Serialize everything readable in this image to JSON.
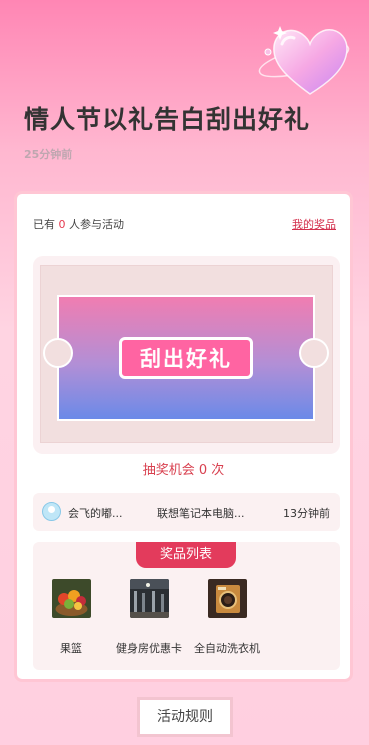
{
  "header": {
    "title": "情人节以礼告白刮出好礼",
    "time_ago": "25分钟前"
  },
  "card": {
    "participants_prefix": "已有",
    "participants_count": "0",
    "participants_suffix": "人参与活动",
    "my_prizes_link": "我的奖品",
    "scratch_label": "刮出好礼",
    "chances_prefix": "抽奖机会",
    "chances_count": "0",
    "chances_suffix": "次",
    "winner": {
      "name": "会飞的嘟...",
      "prize": "联想笔记本电脑...",
      "time": "13分钟前"
    },
    "prize_list_title": "奖品列表",
    "prizes": [
      {
        "name": "果篮",
        "icon": "fruit-basket-image"
      },
      {
        "name": "健身房优惠卡",
        "icon": "gym-image"
      },
      {
        "name": "全自动洗衣机",
        "icon": "washing-machine-image"
      }
    ]
  },
  "rules_button": "活动规则",
  "colors": {
    "accent_red": "#e33b5c",
    "ticket_pink": "#f07db1",
    "ticket_blue": "#6b8ae8",
    "label_pink": "#ff64a2"
  }
}
